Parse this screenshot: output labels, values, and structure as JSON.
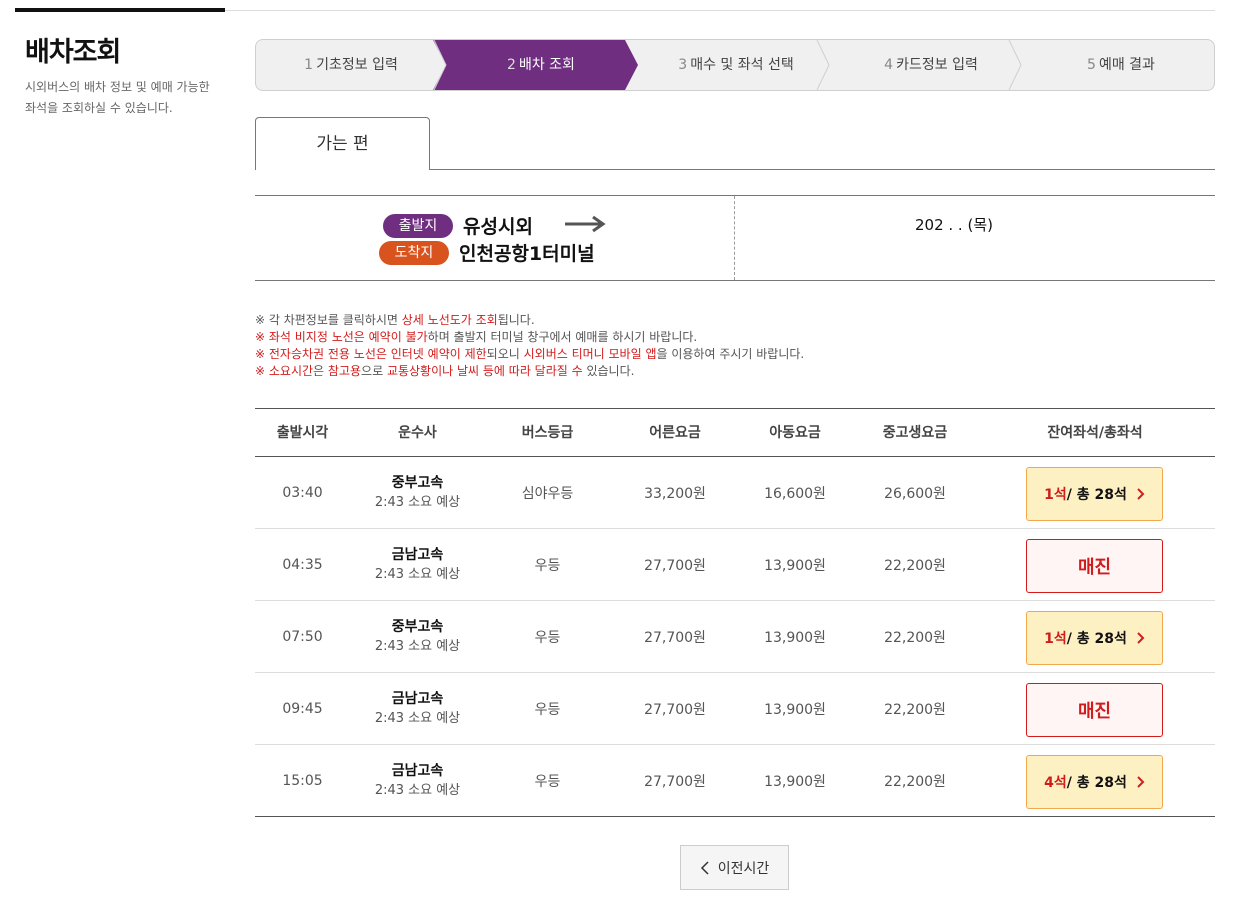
{
  "sidebar": {
    "title": "배차조회",
    "description": "시외버스의 배차 정보 및 예매 가능한 좌석을 조회하실 수 있습니다."
  },
  "steps": [
    {
      "num": "1",
      "label": "기초정보 입력"
    },
    {
      "num": "2",
      "label": "배차 조회"
    },
    {
      "num": "3",
      "label": "매수 및 좌석 선택"
    },
    {
      "num": "4",
      "label": "카드정보 입력"
    },
    {
      "num": "5",
      "label": "예매 결과"
    }
  ],
  "tab": {
    "label": "가는 편"
  },
  "route": {
    "dep_badge": "출발지",
    "dep_place": "유성시외",
    "arr_badge": "도착지",
    "arr_place": "인천공항1터미널",
    "date": "202  .  .    (목)"
  },
  "notes": {
    "n1a": "※ 각 차편정보를 클릭하시면 ",
    "n1b": "상세 노선도가 조회",
    "n1c": "됩니다.",
    "n2a": "※ ",
    "n2b": "좌석 비지정 노선은 예약이 불가",
    "n2c": "하며 출발지 터미널 창구에서 예매를 하시기 바랍니다.",
    "n3a": "※ ",
    "n3b": "전자승차권 전용 노선은 인터넷 예약이 제한",
    "n3c": "되오니 ",
    "n3d": "시외버스 티머니 모바일 앱",
    "n3e": "을 이용하여 주시기 바랍니다.",
    "n4a": "※ ",
    "n4b": "소요시간",
    "n4c": "은 ",
    "n4d": "참고용",
    "n4e": "으로 ",
    "n4f": "교통상황이나 날씨 등에 따라 달라질 수",
    "n4g": " 있습니다."
  },
  "table": {
    "headers": {
      "time": "출발시각",
      "company": "운수사",
      "grade": "버스등급",
      "adult": "어른요금",
      "child": "아동요금",
      "student": "중고생요금",
      "seats": "잔여좌석/총좌석"
    },
    "rows": [
      {
        "time": "03:40",
        "company": "중부고속",
        "duration": "2:43 소요 예상",
        "grade": "심야우등",
        "adult": "33,200원",
        "child": "16,600원",
        "student": "26,600원",
        "remain": "1석",
        "total": " / 총 28석",
        "soldout": false
      },
      {
        "time": "04:35",
        "company": "금남고속",
        "duration": "2:43 소요 예상",
        "grade": "우등",
        "adult": "27,700원",
        "child": "13,900원",
        "student": "22,200원",
        "soldout_label": "매진",
        "soldout": true
      },
      {
        "time": "07:50",
        "company": "중부고속",
        "duration": "2:43 소요 예상",
        "grade": "우등",
        "adult": "27,700원",
        "child": "13,900원",
        "student": "22,200원",
        "remain": "1석",
        "total": " / 총 28석",
        "soldout": false
      },
      {
        "time": "09:45",
        "company": "금남고속",
        "duration": "2:43 소요 예상",
        "grade": "우등",
        "adult": "27,700원",
        "child": "13,900원",
        "student": "22,200원",
        "soldout_label": "매진",
        "soldout": true
      },
      {
        "time": "15:05",
        "company": "금남고속",
        "duration": "2:43 소요 예상",
        "grade": "우등",
        "adult": "27,700원",
        "child": "13,900원",
        "student": "22,200원",
        "remain": "4석",
        "total": " / 총 28석",
        "soldout": false
      }
    ]
  },
  "prev_button": {
    "label": "이전시간"
  },
  "colors": {
    "accent": "#6f2e7f",
    "arrival": "#d9531e",
    "alert": "#d21c1c",
    "seat_bg": "#fdf1c4"
  }
}
